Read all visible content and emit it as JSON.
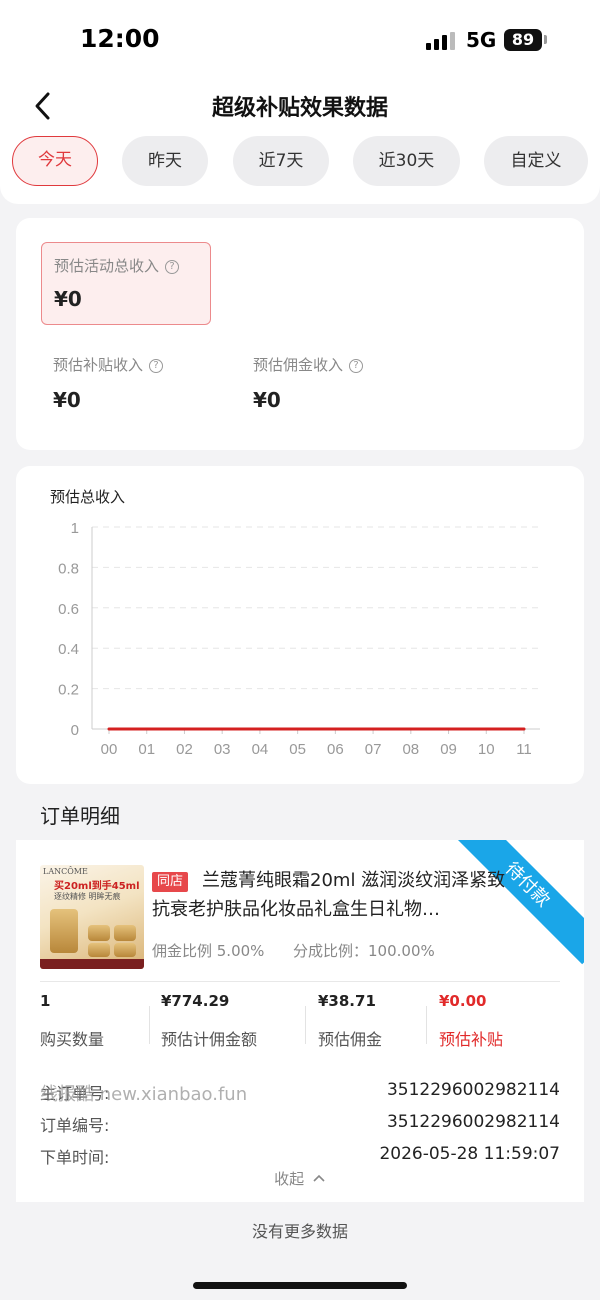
{
  "status_bar": {
    "time": "12:00",
    "network": "5G",
    "battery": "89"
  },
  "nav": {
    "title": "超级补贴效果数据"
  },
  "date_tabs": [
    {
      "label": "今天",
      "active": true
    },
    {
      "label": "昨天",
      "active": false
    },
    {
      "label": "近7天",
      "active": false
    },
    {
      "label": "近30天",
      "active": false
    },
    {
      "label": "自定义",
      "active": false
    }
  ],
  "summary": {
    "total_label": "预估活动总收入",
    "total_value": "¥0",
    "subsidy_label": "预估补贴收入",
    "subsidy_value": "¥0",
    "commission_label": "预估佣金收入",
    "commission_value": "¥0",
    "help_glyph": "?"
  },
  "chart_data": {
    "type": "line",
    "title": "预估总收入",
    "categories": [
      "00",
      "01",
      "02",
      "03",
      "04",
      "05",
      "06",
      "07",
      "08",
      "09",
      "10",
      "11"
    ],
    "series": [
      {
        "values": [
          0,
          0,
          0,
          0,
          0,
          0,
          0,
          0,
          0,
          0,
          0,
          0
        ],
        "color": "#d42020"
      }
    ],
    "y_ticks": [
      "0",
      "0.2",
      "0.4",
      "0.6",
      "0.8",
      "1"
    ],
    "ylim": [
      0,
      1
    ],
    "grid": "dashed horizontal"
  },
  "orders": {
    "section_title": "订单明细",
    "item": {
      "status_ribbon": "待付款",
      "store_tag": "同店",
      "product_title": "兰蔻菁纯眼霜20ml 滋润淡纹润泽紧致抗衰老护肤品化妆品礼盒生日礼物…",
      "image": {
        "brand": "LANCÔME",
        "promo_line1": "买20ml到手45ml",
        "promo_line2": "逐纹精修 明眸无痕"
      },
      "commission_ratio": "佣金比例 5.00%",
      "share_ratio": "分成比例：100.00%",
      "stats": [
        {
          "value": "1",
          "label": "购买数量",
          "highlight": false
        },
        {
          "value": "¥774.29",
          "label": "预估计佣金额",
          "highlight": false
        },
        {
          "value": "¥38.71",
          "label": "预估佣金",
          "highlight": false
        },
        {
          "value": "¥0.00",
          "label": "预估补贴",
          "highlight": true
        }
      ],
      "watermark": "线报酷 new.xianbao.fun",
      "info": [
        {
          "label": "主订单号:",
          "value": "3512296002982114"
        },
        {
          "label": "订单编号:",
          "value": "3512296002982114"
        },
        {
          "label": "下单时间:",
          "value": "2026-05-28 11:59:07"
        }
      ],
      "collapse_label": "收起"
    },
    "no_more": "没有更多数据"
  },
  "colors": {
    "accent": "#e0393d",
    "ribbon": "#1aa6e8",
    "chart_line": "#d42020"
  }
}
